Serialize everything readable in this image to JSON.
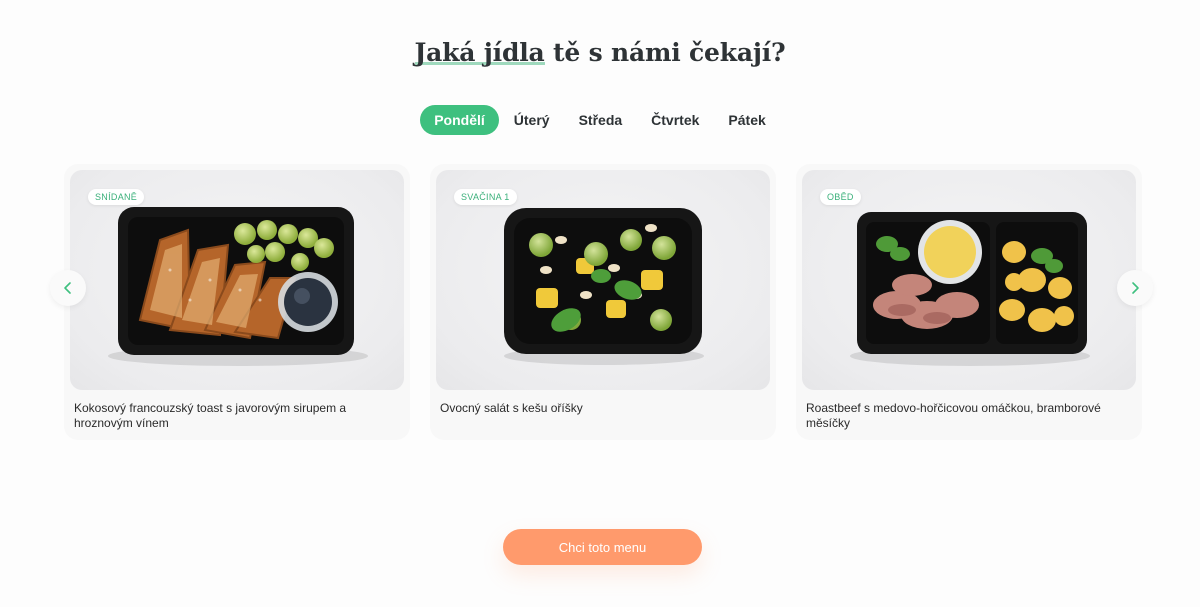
{
  "headline": {
    "accent": "Jaká jídla",
    "rest": " tě s námi čekají?"
  },
  "tabs": [
    {
      "label": "Pondělí",
      "active": true
    },
    {
      "label": "Úterý",
      "active": false
    },
    {
      "label": "Středa",
      "active": false
    },
    {
      "label": "Čtvrtek",
      "active": false
    },
    {
      "label": "Pátek",
      "active": false
    }
  ],
  "meals": [
    {
      "badge": "SNÍDANĚ",
      "name": "Kokosový francouzský toast s javorovým sirupem a hroznovým vínem"
    },
    {
      "badge": "SVAČINA 1",
      "name": "Ovocný salát s kešu oříšky"
    },
    {
      "badge": "OBĚD",
      "name": "Roastbeef s medovo-hořčicovou omáčkou, bramborové měsíčky"
    }
  ],
  "nav": {
    "prev_icon": "chevron-left-icon",
    "next_icon": "chevron-right-icon"
  },
  "cta": {
    "label": "Chci toto menu"
  },
  "colors": {
    "accent_green": "#3ec07f",
    "cta_orange": "#ff9a6c"
  }
}
